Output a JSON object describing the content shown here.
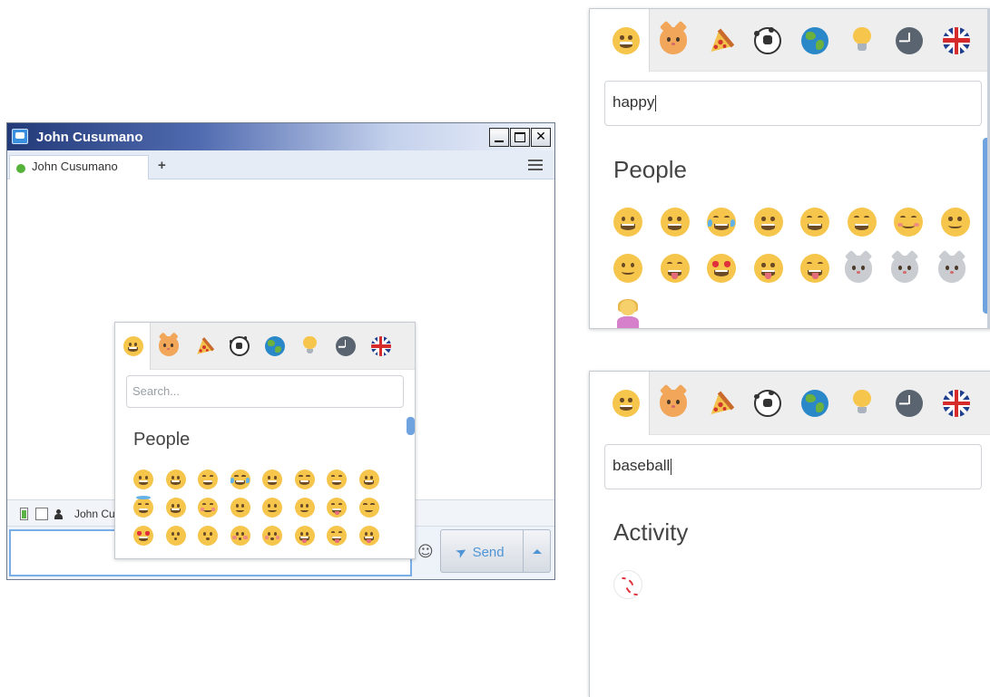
{
  "chat_window": {
    "title": "John Cusumano",
    "tab_label": "John Cusumano",
    "tab_add": "+",
    "info_name": "John Cu",
    "send_label": "Send",
    "status_color": "#56b33a"
  },
  "picker_main": {
    "search_placeholder": "Search...",
    "section": "People",
    "categories": [
      "smile-icon",
      "cat-icon",
      "pizza-icon",
      "soccer-ball-icon",
      "globe-icon",
      "lightbulb-icon",
      "clock-icon",
      "uk-flag-icon"
    ]
  },
  "picker_happy": {
    "search_value": "happy",
    "section": "People"
  },
  "picker_baseball": {
    "search_value": "baseball",
    "section": "Activity"
  }
}
